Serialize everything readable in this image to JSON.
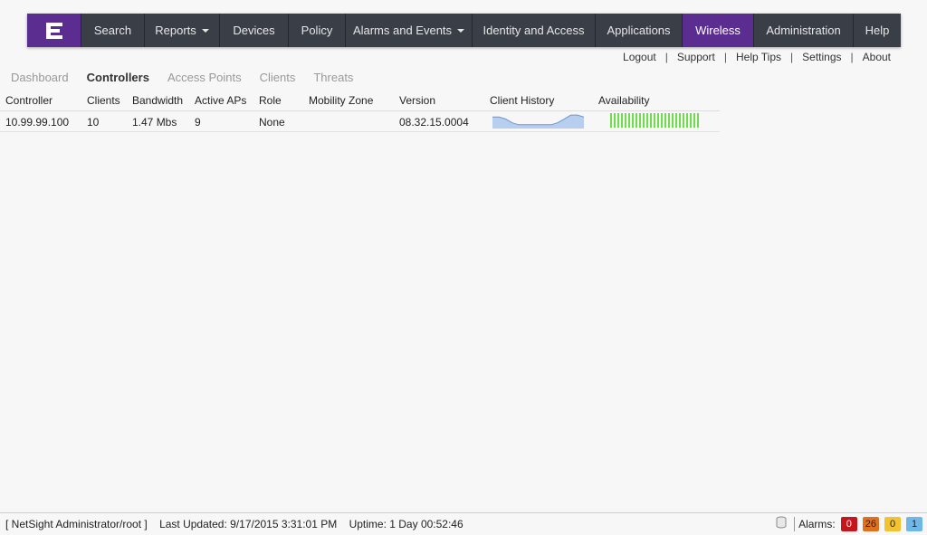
{
  "nav": {
    "logo": "extreme-logo",
    "items": [
      {
        "label": "Search",
        "dropdown": false,
        "active": false
      },
      {
        "label": "Reports",
        "dropdown": true,
        "active": false
      },
      {
        "label": "Devices",
        "dropdown": false,
        "active": false
      },
      {
        "label": "Policy",
        "dropdown": false,
        "active": false
      },
      {
        "label": "Alarms and Events",
        "dropdown": true,
        "active": false
      },
      {
        "label": "Identity and Access",
        "dropdown": false,
        "active": false
      },
      {
        "label": "Applications",
        "dropdown": false,
        "active": false
      },
      {
        "label": "Wireless",
        "dropdown": false,
        "active": true
      },
      {
        "label": "Administration",
        "dropdown": false,
        "active": false
      },
      {
        "label": "Help",
        "dropdown": false,
        "active": false
      }
    ]
  },
  "util_links": [
    "Logout",
    "Support",
    "Help Tips",
    "Settings",
    "About"
  ],
  "subtabs": [
    {
      "label": "Dashboard",
      "active": false
    },
    {
      "label": "Controllers",
      "active": true
    },
    {
      "label": "Access Points",
      "active": false
    },
    {
      "label": "Clients",
      "active": false
    },
    {
      "label": "Threats",
      "active": false
    }
  ],
  "table": {
    "columns": [
      "Controller",
      "Clients",
      "Bandwidth",
      "Active APs",
      "Role",
      "Mobility Zone",
      "Version",
      "Client History",
      "Availability"
    ],
    "rows": [
      {
        "controller": "10.99.99.100",
        "clients": "10",
        "bandwidth": "1.47 Mbs",
        "active_aps": "9",
        "role": "None",
        "mobility_zone": "",
        "version": "08.32.15.0004",
        "client_history": [
          6,
          6,
          5,
          3,
          2,
          2,
          2,
          2,
          2,
          2,
          3,
          5,
          7,
          7,
          6
        ],
        "availability": [
          1,
          1,
          1,
          1,
          1,
          1,
          1,
          1,
          1,
          1,
          1,
          1,
          1,
          1,
          1,
          1,
          1,
          1,
          1,
          1,
          1,
          1,
          1,
          1,
          1
        ]
      }
    ]
  },
  "status": {
    "user": "[ NetSight Administrator/root ]",
    "last_updated": "Last Updated: 9/17/2015 3:31:01 PM",
    "uptime": "Uptime: 1 Day 00:52:46",
    "alarms_label": "Alarms:",
    "alarms": [
      {
        "count": "0",
        "color": "#c4161c",
        "text_color": "#ffffff"
      },
      {
        "count": "26",
        "color": "#e0701e",
        "text_color": "#222222"
      },
      {
        "count": "0",
        "color": "#f2c230",
        "text_color": "#222222"
      },
      {
        "count": "1",
        "color": "#6fb7e6",
        "text_color": "#222222"
      }
    ]
  },
  "colors": {
    "brand": "#5b2d91",
    "nav_bg": "#3a3f47",
    "availability_green": "#6fdc4a",
    "history_fill": "#b8ceef",
    "history_line": "#6a95d6"
  }
}
